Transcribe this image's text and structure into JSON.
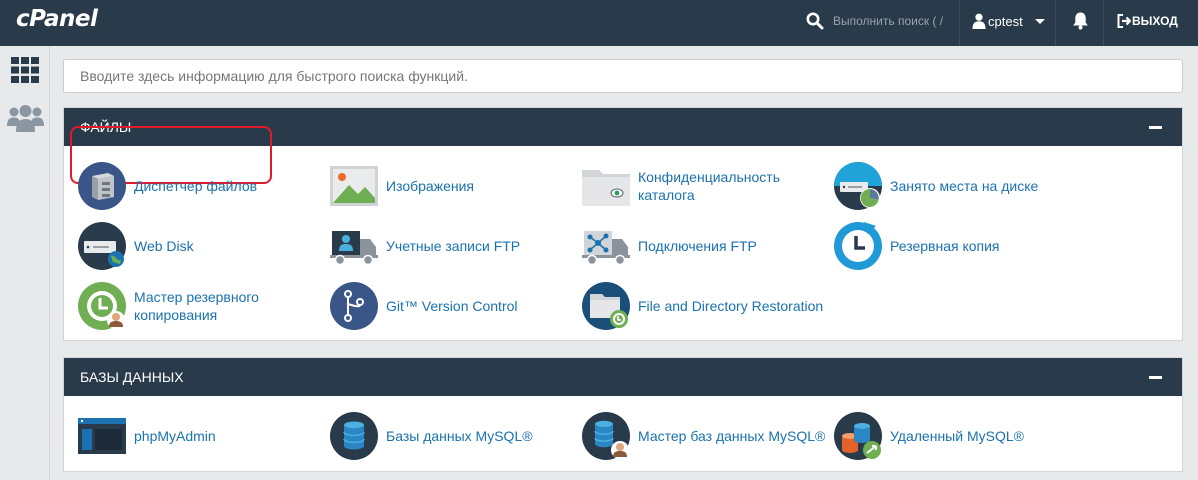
{
  "header": {
    "logo": "cPanel",
    "search_placeholder": "Выполнить поиск ( /",
    "username": "cptest",
    "logout_label": "ВЫХОД"
  },
  "rail": {
    "icons": [
      "grid-icon",
      "users-icon"
    ]
  },
  "quick_search": {
    "placeholder": "Вводите здесь информацию для быстрого поиска функций."
  },
  "sections": {
    "files": {
      "title": "ФАЙЛЫ",
      "items": [
        {
          "label": "Диспетчер файлов",
          "icon": "file-manager-icon",
          "selected": true
        },
        {
          "label": "Изображения",
          "icon": "images-icon"
        },
        {
          "label": "Конфиденциальность каталога",
          "icon": "directory-privacy-icon"
        },
        {
          "label": "Занято места на диске",
          "icon": "disk-usage-icon"
        },
        {
          "label": "Web Disk",
          "icon": "web-disk-icon"
        },
        {
          "label": "Учетные записи FTP",
          "icon": "ftp-accounts-icon"
        },
        {
          "label": "Подключения FTP",
          "icon": "ftp-connections-icon"
        },
        {
          "label": "Резервная копия",
          "icon": "backup-icon"
        },
        {
          "label": "Мастер резервного копирования",
          "icon": "backup-wizard-icon"
        },
        {
          "label": "Git™ Version Control",
          "icon": "git-icon"
        },
        {
          "label": "File and Directory Restoration",
          "icon": "file-restoration-icon"
        }
      ]
    },
    "databases": {
      "title": "БАЗЫ ДАННЫХ",
      "items": [
        {
          "label": "phpMyAdmin",
          "icon": "phpmyadmin-icon"
        },
        {
          "label": "Базы данных MySQL®",
          "icon": "mysql-databases-icon"
        },
        {
          "label": "Мастер баз данных MySQL®",
          "icon": "mysql-wizard-icon"
        },
        {
          "label": "Удаленный MySQL®",
          "icon": "remote-mysql-icon"
        }
      ]
    }
  },
  "colors": {
    "header": "#293a4a",
    "link": "#1a72b0",
    "highlight": "#e0192b",
    "background": "#e8e9ea"
  }
}
